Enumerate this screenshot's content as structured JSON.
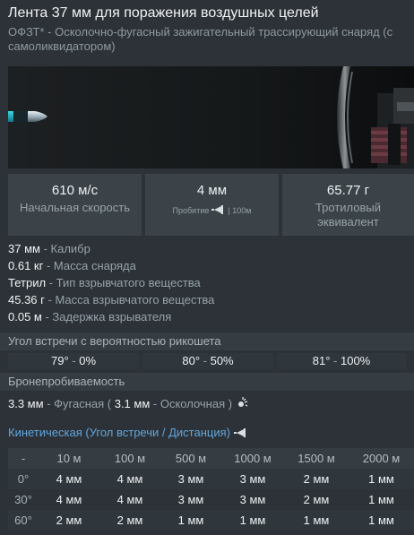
{
  "header": {
    "title": "Лента 37 мм для поражения воздушных целей",
    "subtitle": "ОФЗТ* - Осколочно-фугасный зажигательный трассирующий снаряд (с самоликвидатором)"
  },
  "preview": {
    "icon": "shell-render-image"
  },
  "stats": [
    {
      "value": "610 м/с",
      "label": "Начальная скорость"
    },
    {
      "value": "4 мм",
      "label": "Пробитие",
      "suffix": "| 100м",
      "icon": "penetration-icon"
    },
    {
      "value": "65.77 г",
      "label": "Тротиловый эквивалент"
    }
  ],
  "properties": [
    {
      "value": "37 мм",
      "desc": "- Калибр"
    },
    {
      "value": "0.61 кг",
      "desc": "- Масса снаряда"
    },
    {
      "value": "Тетрил",
      "desc": "- Тип взрывчатого вещества"
    },
    {
      "value": "45.36 г",
      "desc": "- Масса взрывчатого вещества"
    },
    {
      "value": "0.05 м",
      "desc": "- Задержка взрывателя"
    }
  ],
  "ricochet": {
    "title": "Угол встречи с вероятностью рикошета",
    "items": [
      {
        "angle": "79°",
        "prob": "0%"
      },
      {
        "angle": "80°",
        "prob": "50%"
      },
      {
        "angle": "81°",
        "prob": "100%"
      }
    ]
  },
  "armor": {
    "title": "Бронепробиваемость",
    "he_value": "3.3 мм",
    "he_label": "- Фугасная (",
    "frag_value": "3.1 мм",
    "frag_label": "- Осколочная )"
  },
  "kinetic": {
    "title": "Кинетическая (Угол встречи / Дистанция)",
    "headers": [
      "-",
      "10 м",
      "100 м",
      "500 м",
      "1000 м",
      "1500 м",
      "2000 м"
    ],
    "rows": [
      [
        "0°",
        "4 мм",
        "4 мм",
        "3 мм",
        "3 мм",
        "2 мм",
        "1 мм"
      ],
      [
        "30°",
        "4 мм",
        "4 мм",
        "3 мм",
        "3 мм",
        "2 мм",
        "1 мм"
      ],
      [
        "60°",
        "2 мм",
        "2 мм",
        "1 мм",
        "1 мм",
        "1 мм",
        "1 мм"
      ]
    ]
  },
  "colors": {
    "accent": "#63a6dd",
    "background": "#2c3237",
    "tile": "#3b4348"
  }
}
